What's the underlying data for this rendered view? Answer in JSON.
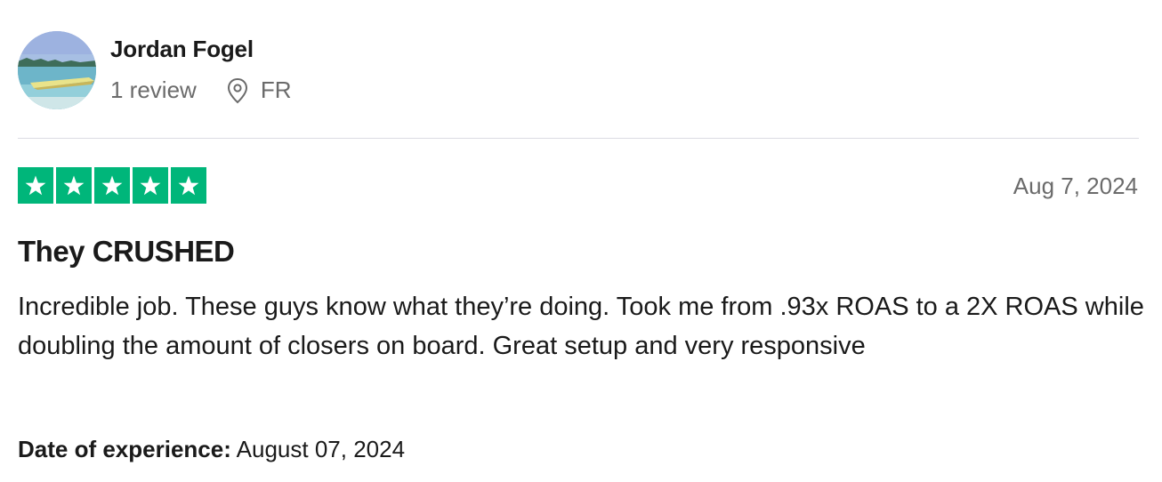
{
  "reviewer": {
    "name": "Jordan Fogel",
    "review_count": "1 review",
    "country": "FR",
    "avatar_icon": "beach-photo-avatar",
    "location_icon": "map-pin-icon"
  },
  "review": {
    "rating": 5,
    "rating_max": 5,
    "star_color": "#00b67a",
    "date": "Aug 7, 2024",
    "title": "They CRUSHED",
    "body": "Incredible job. These guys know what they’re doing. Took me from .93x ROAS to a 2X ROAS while doubling the amount of closers on board. Great setup and very responsive",
    "experience_label": "Date of experience:",
    "experience_date": "August 07, 2024"
  }
}
